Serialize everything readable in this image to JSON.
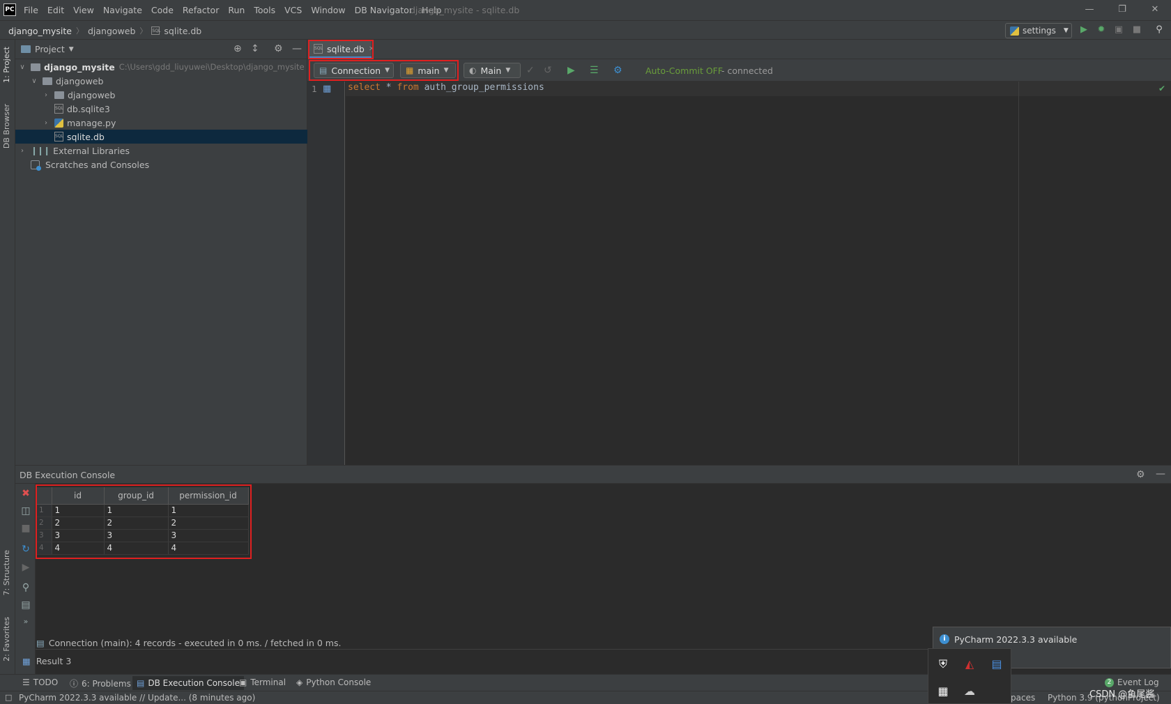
{
  "app": {
    "logo": "PC",
    "window_title": "django_mysite - sqlite.db",
    "menu": [
      "File",
      "Edit",
      "View",
      "Navigate",
      "Code",
      "Refactor",
      "Run",
      "Tools",
      "VCS",
      "Window",
      "DB Navigator",
      "Help"
    ]
  },
  "navbar": {
    "breadcrumbs": [
      "django_mysite",
      "djangoweb",
      "sqlite.db"
    ],
    "run_config": "settings"
  },
  "left_strip": {
    "project_label": "1: Project",
    "db_browser_label": "DB Browser",
    "structure_label": "7: Structure",
    "favorites_label": "2: Favorites"
  },
  "project_panel": {
    "title": "Project",
    "tree": [
      {
        "label": "django_mysite",
        "hint": "C:\\Users\\gdd_liuyuwei\\Desktop\\django_mysite",
        "type": "folder",
        "expanded": true
      },
      {
        "label": "djangoweb",
        "type": "folder",
        "expanded": true
      },
      {
        "label": "djangoweb",
        "type": "folder",
        "expanded": false
      },
      {
        "label": "db.sqlite3",
        "type": "file"
      },
      {
        "label": "manage.py",
        "type": "python"
      },
      {
        "label": "sqlite.db",
        "type": "file",
        "selected": true
      },
      {
        "label": "External Libraries",
        "type": "library"
      },
      {
        "label": "Scratches and Consoles",
        "type": "scratch"
      }
    ]
  },
  "editor": {
    "tab": "sqlite.db",
    "connection_label": "Connection",
    "schema_label": "main",
    "session_label": "Main",
    "autocommit": "Auto-Commit OFF",
    "connected": " - connected",
    "line_numbers": [
      "1"
    ],
    "code": {
      "kw1": "select",
      "star": " * ",
      "kw2": "from",
      "table": " auth_group_permissions"
    }
  },
  "console": {
    "title": "DB Execution Console",
    "columns": [
      "id",
      "group_id",
      "permission_id"
    ],
    "rows": [
      {
        "n": "1",
        "id": "1",
        "group_id": "1",
        "permission_id": "1"
      },
      {
        "n": "2",
        "id": "2",
        "group_id": "2",
        "permission_id": "2"
      },
      {
        "n": "3",
        "id": "3",
        "group_id": "3",
        "permission_id": "3"
      },
      {
        "n": "4",
        "id": "4",
        "group_id": "4",
        "permission_id": "4"
      }
    ],
    "status": "Connection (main): 4 records  - executed in 0 ms. / fetched in 0 ms.",
    "result": "Result 3"
  },
  "bottom_tabs": [
    "TODO",
    "6: Problems",
    "DB Execution Console",
    "Terminal",
    "Python Console"
  ],
  "bottom_right": {
    "event_log": "Event Log",
    "event_count": "2",
    "spaces": "paces",
    "interpreter": "Python 3.9 (pythonProject)"
  },
  "status_message": "PyCharm 2022.3.3 available // Update... (8 minutes ago)",
  "notification": {
    "title": "PyCharm 2022.3.3 available"
  },
  "watermark": "CSDN @鱼尾酱",
  "colors": {
    "accent": "#4a88c7",
    "highlight_box": "#e02020",
    "keyword": "#cc7832",
    "connected_green": "#6a9e3b"
  }
}
